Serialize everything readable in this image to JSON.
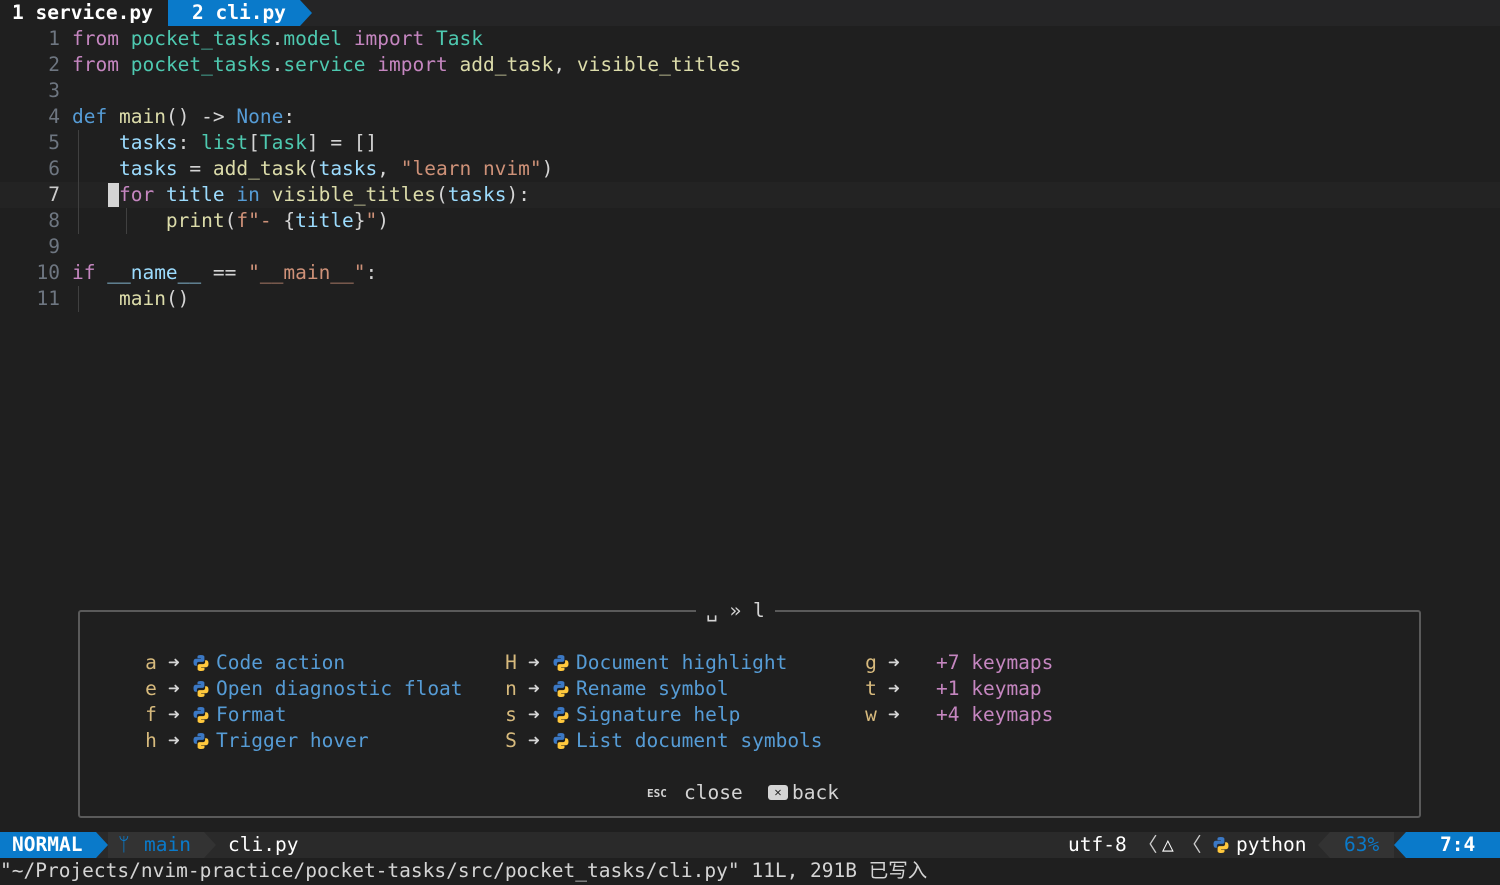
{
  "tabs": [
    {
      "label": "1 service.py"
    },
    {
      "label": "2 cli.py"
    }
  ],
  "editor": {
    "lines": [
      {
        "num": "1",
        "parts": [
          [
            "kw",
            "from"
          ],
          [
            "pl",
            " "
          ],
          [
            "mod",
            "pocket_tasks"
          ],
          [
            "pl",
            "."
          ],
          [
            "mod",
            "model"
          ],
          [
            "pl",
            " "
          ],
          [
            "kw",
            "import"
          ],
          [
            "pl",
            " "
          ],
          [
            "mod",
            "Task"
          ]
        ]
      },
      {
        "num": "2",
        "parts": [
          [
            "kw",
            "from"
          ],
          [
            "pl",
            " "
          ],
          [
            "mod",
            "pocket_tasks"
          ],
          [
            "pl",
            "."
          ],
          [
            "mod",
            "service"
          ],
          [
            "pl",
            " "
          ],
          [
            "kw",
            "import"
          ],
          [
            "pl",
            " "
          ],
          [
            "fn",
            "add_task"
          ],
          [
            "pl",
            ", "
          ],
          [
            "fn",
            "visible_titles"
          ]
        ]
      },
      {
        "num": "3",
        "parts": []
      },
      {
        "num": "4",
        "parts": [
          [
            "kb",
            "def"
          ],
          [
            "pl",
            " "
          ],
          [
            "fn",
            "main"
          ],
          [
            "pl",
            "() -> "
          ],
          [
            "kb",
            "None"
          ],
          [
            "pl",
            ":"
          ]
        ]
      },
      {
        "num": "5",
        "parts": [
          [
            "pl",
            "    "
          ],
          [
            "var",
            "tasks"
          ],
          [
            "pl",
            ": "
          ],
          [
            "mod",
            "list"
          ],
          [
            "pl",
            "["
          ],
          [
            "mod",
            "Task"
          ],
          [
            "pl",
            "] = []"
          ]
        ]
      },
      {
        "num": "6",
        "parts": [
          [
            "pl",
            "    "
          ],
          [
            "var",
            "tasks"
          ],
          [
            "pl",
            " = "
          ],
          [
            "fn",
            "add_task"
          ],
          [
            "pl",
            "("
          ],
          [
            "var",
            "tasks"
          ],
          [
            "pl",
            ", "
          ],
          [
            "str",
            "\"learn nvim\""
          ],
          [
            "pl",
            ")"
          ]
        ]
      },
      {
        "num": "7",
        "parts": [
          [
            "pl",
            "    "
          ],
          [
            "kw",
            "for"
          ],
          [
            "pl",
            " "
          ],
          [
            "var",
            "title"
          ],
          [
            "pl",
            " "
          ],
          [
            "kb",
            "in"
          ],
          [
            "pl",
            " "
          ],
          [
            "fn",
            "visible_titles"
          ],
          [
            "pl",
            "("
          ],
          [
            "var",
            "tasks"
          ],
          [
            "pl",
            "):"
          ]
        ]
      },
      {
        "num": "8",
        "parts": [
          [
            "pl",
            "        "
          ],
          [
            "fn",
            "print"
          ],
          [
            "pl",
            "("
          ],
          [
            "str",
            "f\"- "
          ],
          [
            "pl",
            "{"
          ],
          [
            "var",
            "title"
          ],
          [
            "pl",
            "}"
          ],
          [
            "str",
            "\""
          ],
          [
            "pl",
            ")"
          ]
        ]
      },
      {
        "num": "9",
        "parts": []
      },
      {
        "num": "10",
        "parts": [
          [
            "kw",
            "if"
          ],
          [
            "pl",
            " "
          ],
          [
            "var",
            "__name__"
          ],
          [
            "pl",
            " == "
          ],
          [
            "str",
            "\"__main__\""
          ],
          [
            "pl",
            ":"
          ]
        ]
      },
      {
        "num": "11",
        "parts": [
          [
            "pl",
            "    "
          ],
          [
            "fn",
            "main"
          ],
          [
            "pl",
            "()"
          ]
        ]
      }
    ]
  },
  "whichkey": {
    "title": "␣ » l",
    "col1": [
      {
        "key": "a",
        "label": "Code action"
      },
      {
        "key": "e",
        "label": "Open diagnostic float"
      },
      {
        "key": "f",
        "label": "Format"
      },
      {
        "key": "h",
        "label": "Trigger hover"
      }
    ],
    "col2": [
      {
        "key": "H",
        "label": "Document highlight"
      },
      {
        "key": "n",
        "label": "Rename symbol"
      },
      {
        "key": "s",
        "label": "Signature help"
      },
      {
        "key": "S",
        "label": "List document symbols"
      }
    ],
    "col3": [
      {
        "key": "g",
        "label": "+7 keymaps"
      },
      {
        "key": "t",
        "label": "+1 keymap"
      },
      {
        "key": "w",
        "label": "+4 keymaps"
      }
    ],
    "arrow": "➜",
    "esc_label": "ESC",
    "close_label": "close",
    "back_label": "back"
  },
  "statusline": {
    "mode": "NORMAL",
    "branch_icon": "",
    "branch": "main",
    "filename": "cli.py",
    "encoding": "utf-8",
    "os_icon": "linux-icon",
    "filetype": "python",
    "percent": "63%",
    "position": "7:4"
  },
  "cmdline": "\"~/Projects/nvim-practice/pocket-tasks/src/pocket_tasks/cli.py\" 11L, 291B 已写入",
  "colors": {
    "accent": "#0a7aca",
    "keyword": "#c586c0",
    "builtin": "#569cd6",
    "module": "#4ec9b0",
    "function": "#dcdcaa",
    "variable": "#9cdcfe",
    "string": "#ce9178"
  }
}
